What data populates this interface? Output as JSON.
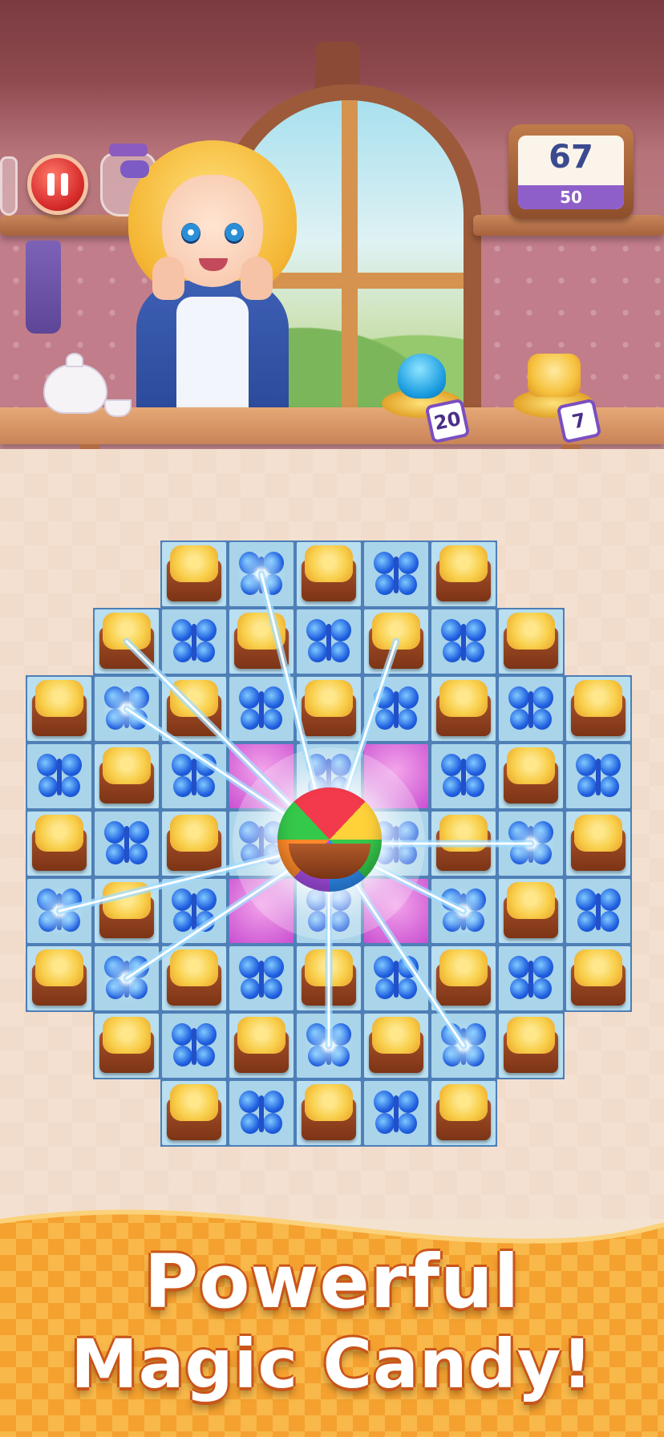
{
  "hud": {
    "pause_icon": "pause-icon",
    "moves_remaining": "67",
    "moves_sub": "50",
    "goals": [
      {
        "icon": "blue-jelly-icon",
        "count": "20"
      },
      {
        "icon": "cookie-tile-icon",
        "count": "7"
      }
    ]
  },
  "caption": {
    "line1": "Powerful",
    "line2": "Magic Candy!"
  },
  "board": {
    "rows": [
      "  CBCBC  ",
      " CBCBCBC ",
      "CBCBCBCBC",
      "BCBPBPBCB",
      "CBCBMBCBC",
      "BCBPBPBCB",
      "CBCBCBCBC",
      " CBCBCBC ",
      "  CBCBC  "
    ],
    "legend": {
      "C": "cookie-tile",
      "B": "blue-butterfly-candy",
      "P": "pink-special-tile",
      "M": "magic-candy-ball"
    },
    "charged_tiles": [
      [
        0,
        3
      ],
      [
        1,
        1
      ],
      [
        1,
        5
      ],
      [
        2,
        1
      ],
      [
        4,
        7
      ],
      [
        5,
        0
      ],
      [
        5,
        6
      ],
      [
        6,
        1
      ],
      [
        7,
        4
      ],
      [
        7,
        6
      ]
    ]
  },
  "colors": {
    "accent_orange": "#f39a2e",
    "board_frame": "#4f7fb6",
    "cell_light": "#b9dff0",
    "moves_strip": "#8f5fc9"
  }
}
